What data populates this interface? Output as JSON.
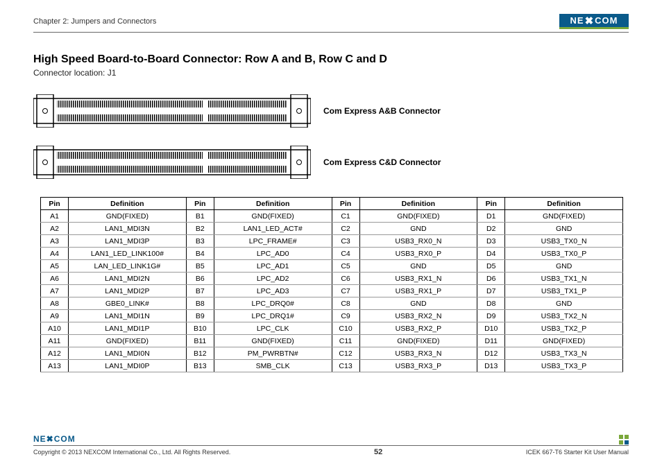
{
  "header": {
    "chapter": "Chapter 2: Jumpers and Connectors",
    "logo_text": "NE COM",
    "logo_x": "✖"
  },
  "main": {
    "title": "High Speed Board-to-Board Connector: Row A and B, Row C and D",
    "subtitle": "Connector location: J1",
    "connector_ab_label": "Com Express A&B Connector",
    "connector_cd_label": "Com Express C&D Connector"
  },
  "table": {
    "headers": {
      "pin": "Pin",
      "def": "Definition"
    },
    "rows": [
      {
        "a": "A1",
        "ad": "GND(FIXED)",
        "b": "B1",
        "bd": "GND(FIXED)",
        "c": "C1",
        "cd": "GND(FIXED)",
        "d": "D1",
        "dd": "GND(FIXED)"
      },
      {
        "a": "A2",
        "ad": "LAN1_MDI3N",
        "b": "B2",
        "bd": "LAN1_LED_ACT#",
        "c": "C2",
        "cd": "GND",
        "d": "D2",
        "dd": "GND"
      },
      {
        "a": "A3",
        "ad": "LAN1_MDI3P",
        "b": "B3",
        "bd": "LPC_FRAME#",
        "c": "C3",
        "cd": "USB3_RX0_N",
        "d": "D3",
        "dd": "USB3_TX0_N"
      },
      {
        "a": "A4",
        "ad": "LAN1_LED_LINK100#",
        "b": "B4",
        "bd": "LPC_AD0",
        "c": "C4",
        "cd": "USB3_RX0_P",
        "d": "D4",
        "dd": "USB3_TX0_P"
      },
      {
        "a": "A5",
        "ad": "LAN_LED_LINK1G#",
        "b": "B5",
        "bd": "LPC_AD1",
        "c": "C5",
        "cd": "GND",
        "d": "D5",
        "dd": "GND"
      },
      {
        "a": "A6",
        "ad": "LAN1_MDI2N",
        "b": "B6",
        "bd": "LPC_AD2",
        "c": "C6",
        "cd": "USB3_RX1_N",
        "d": "D6",
        "dd": "USB3_TX1_N"
      },
      {
        "a": "A7",
        "ad": "LAN1_MDI2P",
        "b": "B7",
        "bd": "LPC_AD3",
        "c": "C7",
        "cd": "USB3_RX1_P",
        "d": "D7",
        "dd": "USB3_TX1_P"
      },
      {
        "a": "A8",
        "ad": "GBE0_LINK#",
        "b": "B8",
        "bd": "LPC_DRQ0#",
        "c": "C8",
        "cd": "GND",
        "d": "D8",
        "dd": "GND"
      },
      {
        "a": "A9",
        "ad": "LAN1_MDI1N",
        "b": "B9",
        "bd": "LPC_DRQ1#",
        "c": "C9",
        "cd": "USB3_RX2_N",
        "d": "D9",
        "dd": "USB3_TX2_N"
      },
      {
        "a": "A10",
        "ad": "LAN1_MDI1P",
        "b": "B10",
        "bd": "LPC_CLK",
        "c": "C10",
        "cd": "USB3_RX2_P",
        "d": "D10",
        "dd": "USB3_TX2_P"
      },
      {
        "a": "A11",
        "ad": "GND(FIXED)",
        "b": "B11",
        "bd": "GND(FIXED)",
        "c": "C11",
        "cd": "GND(FIXED)",
        "d": "D11",
        "dd": "GND(FIXED)"
      },
      {
        "a": "A12",
        "ad": "LAN1_MDI0N",
        "b": "B12",
        "bd": "PM_PWRBTN#",
        "c": "C12",
        "cd": "USB3_RX3_N",
        "d": "D12",
        "dd": "USB3_TX3_N"
      },
      {
        "a": "A13",
        "ad": "LAN1_MDI0P",
        "b": "B13",
        "bd": "SMB_CLK",
        "c": "C13",
        "cd": "USB3_RX3_P",
        "d": "D13",
        "dd": "USB3_TX3_P"
      }
    ]
  },
  "footer": {
    "copyright": "Copyright © 2013 NEXCOM International Co., Ltd. All Rights Reserved.",
    "page": "52",
    "manual": "ICEK 667-T6 Starter Kit User Manual",
    "logo_text": "NE✖COM"
  }
}
